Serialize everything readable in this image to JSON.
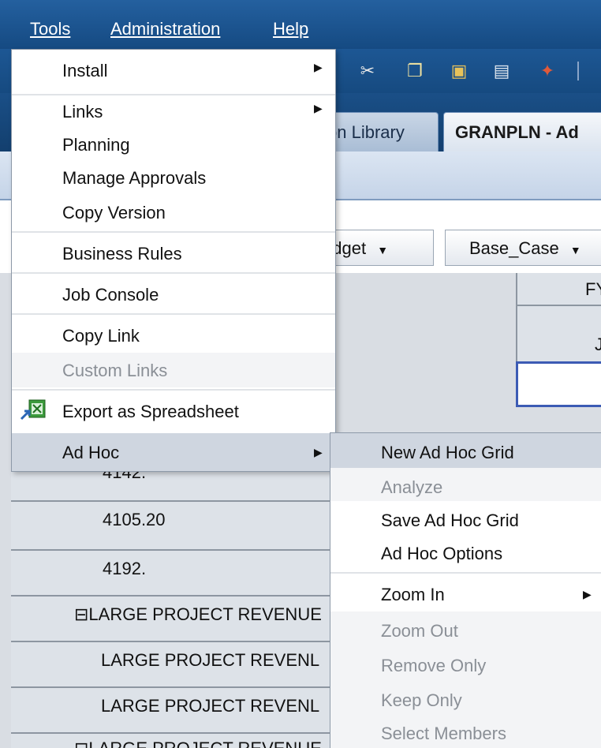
{
  "menubar": {
    "tools": "Tools",
    "administration": "Administration",
    "help": "Help"
  },
  "toolbar": {
    "icons": [
      "cut-icon",
      "copy-icon",
      "paste-icon",
      "properties-icon",
      "pin-icon"
    ]
  },
  "tabs": {
    "library": "on Library",
    "active": "GRANPLN - Ad"
  },
  "pov": {
    "budget": "udget",
    "scenario": "Base_Case"
  },
  "grid": {
    "col_header_top": "FY",
    "col_header_sub": "J",
    "rows": [
      "4142.",
      "4105.20",
      "4192.",
      "⊟LARGE PROJECT REVENUE",
      "LARGE PROJECT REVENL",
      "LARGE PROJECT REVENL",
      "⊟LARGE PROJECT REVENUE"
    ]
  },
  "tools_menu": {
    "install": "Install",
    "links": "Links",
    "planning": "Planning",
    "manage_approvals": "Manage Approvals",
    "copy_version": "Copy Version",
    "business_rules": "Business Rules",
    "job_console": "Job Console",
    "copy_link": "Copy Link",
    "custom_links": "Custom Links",
    "export_spreadsheet": "Export as Spreadsheet",
    "ad_hoc": "Ad Hoc"
  },
  "adhoc_menu": {
    "new_grid": "New Ad Hoc Grid",
    "analyze": "Analyze",
    "save_grid": "Save Ad Hoc Grid",
    "options": "Ad Hoc Options",
    "zoom_in": "Zoom In",
    "zoom_out": "Zoom Out",
    "remove_only": "Remove Only",
    "keep_only": "Keep Only",
    "select_members": "Select Members"
  },
  "colors": {
    "menubar": "#1d5794",
    "highlight": "#cfd6e0",
    "disabled": "#8a8f96"
  }
}
